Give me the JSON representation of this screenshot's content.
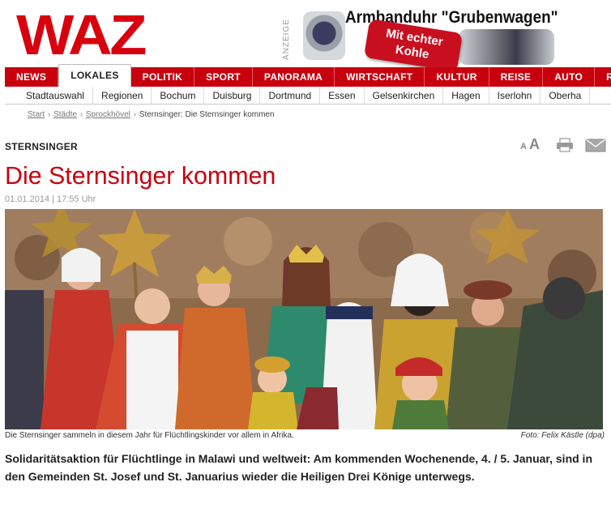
{
  "brand": {
    "logo": "WAZ",
    "color": "#c8000e"
  },
  "ad": {
    "tag": "ANZEIGE",
    "title": "Armbanduhr \"Grubenwagen\"",
    "badge_line1": "Mit echter",
    "badge_line2": "Kohle"
  },
  "main_nav": [
    {
      "label": "NEWS"
    },
    {
      "label": "LOKALES",
      "active": true
    },
    {
      "label": "POLITIK"
    },
    {
      "label": "SPORT"
    },
    {
      "label": "PANORAMA"
    },
    {
      "label": "WIRTSCHAFT"
    },
    {
      "label": "KULTUR"
    },
    {
      "label": "REISE"
    },
    {
      "label": "AUTO"
    },
    {
      "label": "RA"
    }
  ],
  "sub_nav": [
    {
      "label": "Stadtauswahl"
    },
    {
      "label": "Regionen"
    },
    {
      "label": "Bochum"
    },
    {
      "label": "Duisburg"
    },
    {
      "label": "Dortmund"
    },
    {
      "label": "Essen"
    },
    {
      "label": "Gelsenkirchen"
    },
    {
      "label": "Hagen"
    },
    {
      "label": "Iserlohn"
    },
    {
      "label": "Oberha"
    }
  ],
  "breadcrumb": {
    "items": [
      "Start",
      "Städte",
      "Sprockhövel"
    ],
    "separator": "›",
    "current": "Sternsinger: Die Sternsinger kommen"
  },
  "tools": {
    "font_small": "A",
    "font_large": "A",
    "print_icon": "printer-icon",
    "mail_icon": "envelope-icon"
  },
  "article": {
    "kicker": "STERNSINGER",
    "title": "Die Sternsinger kommen",
    "date": "01.01.2014 | 17:55 Uhr",
    "caption": "Die Sternsinger sammeln in diesem Jahr für Flüchtlingskinder vor allem in Afrika.",
    "credit": "Foto: Felix Kästle (dpa)",
    "lead": "Solidaritätsaktion für Flüchtlinge in Malawi und weltweit: Am kommenden Wochenende, 4. / 5. Januar, sind in den Gemeinden St. Josef und St. Januarius wieder die Heiligen Drei Könige unterwegs."
  }
}
